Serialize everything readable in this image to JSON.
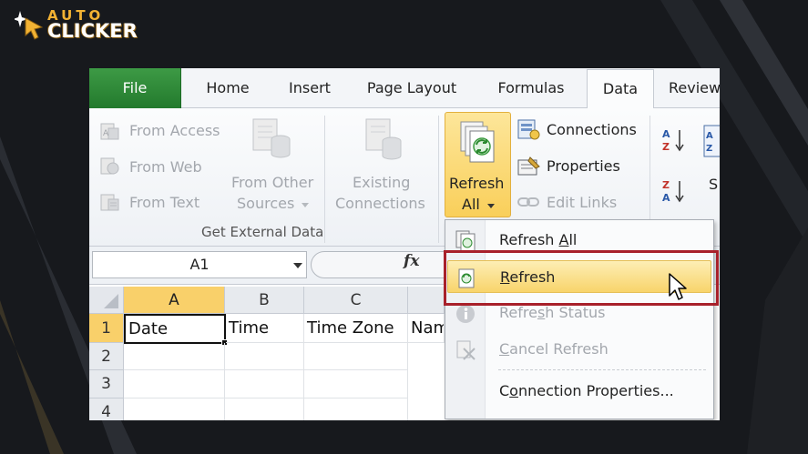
{
  "branding": {
    "line1": "AUTO",
    "line2": "CLICKER"
  },
  "colors": {
    "background": "#17191d",
    "file_tab": "#2a8535",
    "highlight": "#f9d06a",
    "callout": "#a8202a"
  },
  "tabs": [
    {
      "label": "File",
      "name": "file"
    },
    {
      "label": "Home",
      "name": "home"
    },
    {
      "label": "Insert",
      "name": "insert"
    },
    {
      "label": "Page Layout",
      "name": "page-layout"
    },
    {
      "label": "Formulas",
      "name": "formulas"
    },
    {
      "label": "Data",
      "name": "data",
      "active": true
    },
    {
      "label": "Review",
      "name": "review"
    }
  ],
  "ribbon": {
    "get_external": {
      "from_access": "From Access",
      "from_web": "From Web",
      "from_text": "From Text",
      "from_other_l1": "From Other",
      "from_other_l2": "Sources",
      "existing_l1": "Existing",
      "existing_l2": "Connections",
      "group_label": "Get External Data"
    },
    "connections": {
      "refresh_all_l1": "Refresh",
      "refresh_all_l2": "All",
      "connections": "Connections",
      "properties": "Properties",
      "edit_links": "Edit Links"
    },
    "sort": {
      "sort_partial": "S"
    }
  },
  "formula_bar": {
    "cell_ref": "A1",
    "fx": "fx",
    "value": ""
  },
  "sheet": {
    "columns": [
      "A",
      "B",
      "C"
    ],
    "rows": [
      "1",
      "2",
      "3",
      "4"
    ],
    "row1": [
      "Date",
      "Time",
      "Time Zone",
      "Nam"
    ]
  },
  "menu": {
    "items": [
      {
        "name": "refresh-all",
        "pre": "Refresh ",
        "key": "A",
        "post": "ll",
        "disabled": false
      },
      {
        "name": "refresh",
        "pre": "",
        "key": "R",
        "post": "efresh",
        "disabled": false,
        "highlighted": true
      },
      {
        "name": "refresh-status",
        "pre": "Refre",
        "key": "s",
        "post": "h Status",
        "disabled": true
      },
      {
        "name": "cancel-refresh",
        "pre": "",
        "key": "C",
        "post": "ancel Refresh",
        "disabled": true
      },
      {
        "name": "connection-properties",
        "pre": "C",
        "key": "o",
        "post": "nnection Properties...",
        "disabled": false
      }
    ]
  }
}
